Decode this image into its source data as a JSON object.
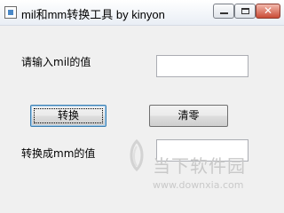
{
  "window": {
    "title": "mil和mm转换工具  by kinyon",
    "minimize_glyph": "",
    "close_glyph": "✕"
  },
  "form": {
    "mil_label": "请输入mil的值",
    "mil_value": "",
    "convert_label": "转换",
    "clear_label": "清零",
    "mm_label": "转换成mm的值",
    "mm_value": ""
  },
  "watermark": {
    "brand": "当下软件园",
    "url": "www.downxia.com"
  }
}
